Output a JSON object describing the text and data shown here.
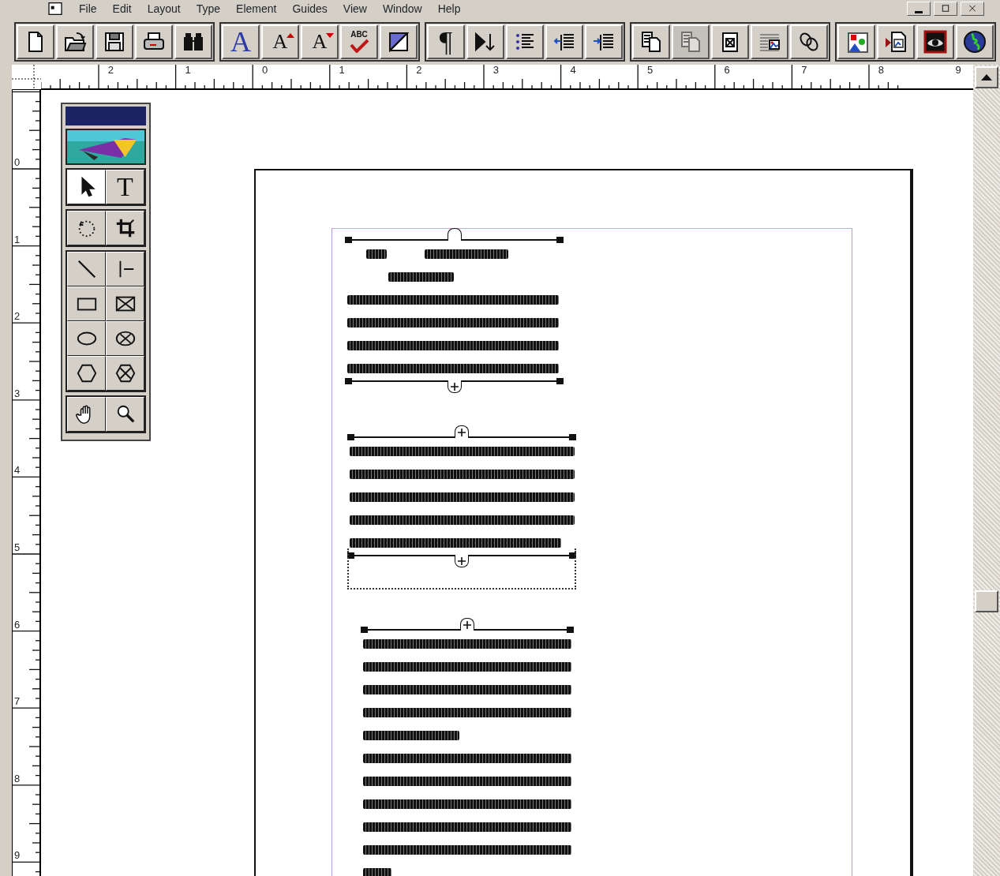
{
  "menu": [
    "File",
    "Edit",
    "Layout",
    "Type",
    "Element",
    "Guides",
    "View",
    "Window",
    "Help"
  ],
  "toolbar": [
    [
      {
        "kind": "new",
        "disabled": false
      },
      {
        "kind": "open",
        "disabled": false
      },
      {
        "kind": "save",
        "disabled": false
      },
      {
        "kind": "print",
        "disabled": false
      },
      {
        "kind": "find",
        "disabled": false
      }
    ],
    [
      {
        "kind": "glyph",
        "label": "A",
        "disabled": false
      },
      {
        "kind": "grow",
        "label": "A",
        "disabled": false
      },
      {
        "kind": "shrink",
        "label": "A",
        "disabled": false
      },
      {
        "kind": "spell",
        "label": "ABC",
        "disabled": false
      },
      {
        "kind": "fill",
        "disabled": false
      }
    ],
    [
      {
        "kind": "glyph",
        "label": "¶",
        "disabled": false
      },
      {
        "kind": "flow",
        "disabled": false
      },
      {
        "kind": "bullets",
        "disabled": false
      },
      {
        "kind": "outdent",
        "disabled": false
      },
      {
        "kind": "indent",
        "disabled": false
      }
    ],
    [
      {
        "kind": "copy",
        "disabled": false
      },
      {
        "kind": "copy",
        "disabled": true
      },
      {
        "kind": "frame",
        "disabled": false
      },
      {
        "kind": "place",
        "disabled": false
      },
      {
        "kind": "links",
        "disabled": false
      }
    ],
    [
      {
        "kind": "shapes",
        "disabled": false
      },
      {
        "kind": "export",
        "disabled": false
      },
      {
        "kind": "eye",
        "disabled": false
      },
      {
        "kind": "globe",
        "disabled": false
      }
    ]
  ],
  "rulers": {
    "horizontal": [
      "2",
      "1",
      "0",
      "1",
      "2",
      "3",
      "4",
      "5",
      "6",
      "7",
      "8",
      "9"
    ],
    "vertical": [
      "0",
      "1",
      "2",
      "3",
      "4",
      "5",
      "6",
      "7",
      "8",
      "9"
    ]
  },
  "toolbox": {
    "tools": [
      {
        "kind": "pointer",
        "selected": true
      },
      {
        "kind": "glyph",
        "label": "T",
        "selected": false
      },
      {
        "kind": "rotate",
        "selected": false
      },
      {
        "kind": "crop",
        "selected": false
      },
      {
        "kind": "line",
        "selected": false
      },
      {
        "kind": "constrained",
        "selected": false
      },
      {
        "kind": "rect",
        "selected": false
      },
      {
        "kind": "rectframe",
        "selected": false
      },
      {
        "kind": "ellipse",
        "selected": false
      },
      {
        "kind": "ellipseframe",
        "selected": false
      },
      {
        "kind": "polygon",
        "selected": false
      },
      {
        "kind": "polygonframe",
        "selected": false
      },
      {
        "kind": "hand",
        "selected": false
      },
      {
        "kind": "zoom",
        "selected": false
      }
    ]
  },
  "text_blocks": [
    {
      "kind": "story",
      "top_handle": {
        "kind": "empty"
      },
      "bottom_handle": {
        "kind": "plus"
      }
    },
    {
      "kind": "story",
      "top_handle": {
        "kind": "plus"
      },
      "bottom_handle": {
        "kind": "plus"
      }
    },
    {
      "kind": "empty_frame"
    },
    {
      "kind": "story",
      "top_handle": {
        "kind": "plus"
      }
    }
  ]
}
